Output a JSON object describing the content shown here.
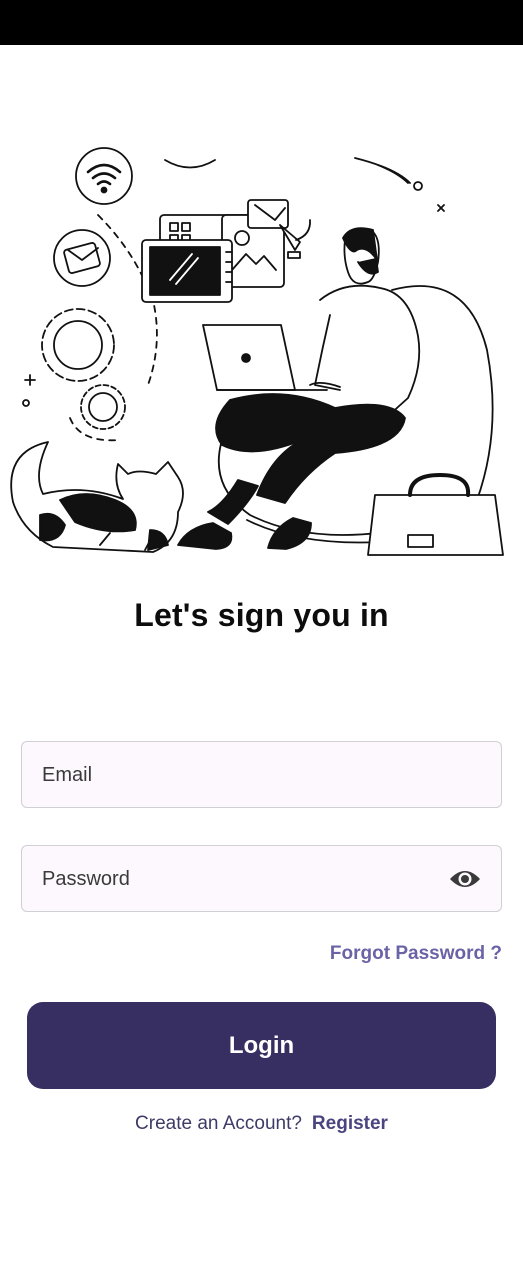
{
  "status_bar": {
    "color": "#000000"
  },
  "illustration": {
    "icon": "person-working-on-laptop-illustration"
  },
  "heading": {
    "title": "Let's sign you in"
  },
  "form": {
    "email_placeholder": "Email",
    "password_placeholder": "Password",
    "password_toggle_icon": "eye-icon",
    "forgot_password_label": "Forgot Password ?",
    "login_label": "Login"
  },
  "footer": {
    "prompt": "Create an Account?",
    "register_label": "Register"
  },
  "colors": {
    "primary": "#372f62",
    "link": "#6a63a6",
    "field_bg": "#fdf8fd"
  }
}
